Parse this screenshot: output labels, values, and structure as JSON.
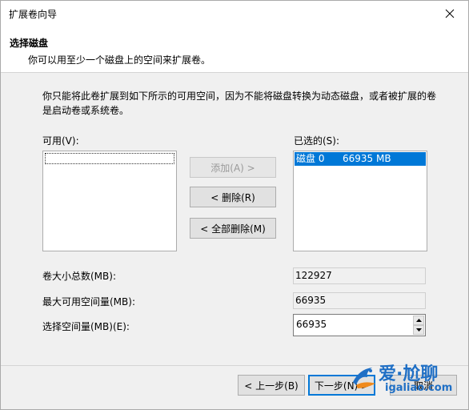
{
  "window": {
    "title": "扩展卷向导"
  },
  "header": {
    "title": "选择磁盘",
    "subtitle": "你可以用至少一个磁盘上的空间来扩展卷。"
  },
  "description": "你只能将此卷扩展到如下所示的可用空间，因为不能将磁盘转换为动态磁盘，或者被扩展的卷是启动卷或系统卷。",
  "available": {
    "label": "可用(V):"
  },
  "selected": {
    "label": "已选的(S):",
    "items": [
      {
        "disk": "磁盘 0",
        "size": "66935 MB"
      }
    ]
  },
  "buttons": {
    "add": "添加(A) >",
    "remove": "< 删除(R)",
    "remove_all": "< 全部删除(M)",
    "back": "< 上一步(B)",
    "next": "下一步(N) >",
    "cancel": "取消"
  },
  "fields": {
    "total_label": "卷大小总数(MB):",
    "total_value": "122927",
    "max_label": "最大可用空间量(MB):",
    "max_value": "66935",
    "select_label": "选择空间量(MB)(E):",
    "select_value": "66935"
  },
  "watermark": {
    "line1": "爱·尬聊",
    "line2": "igaliao.com"
  }
}
